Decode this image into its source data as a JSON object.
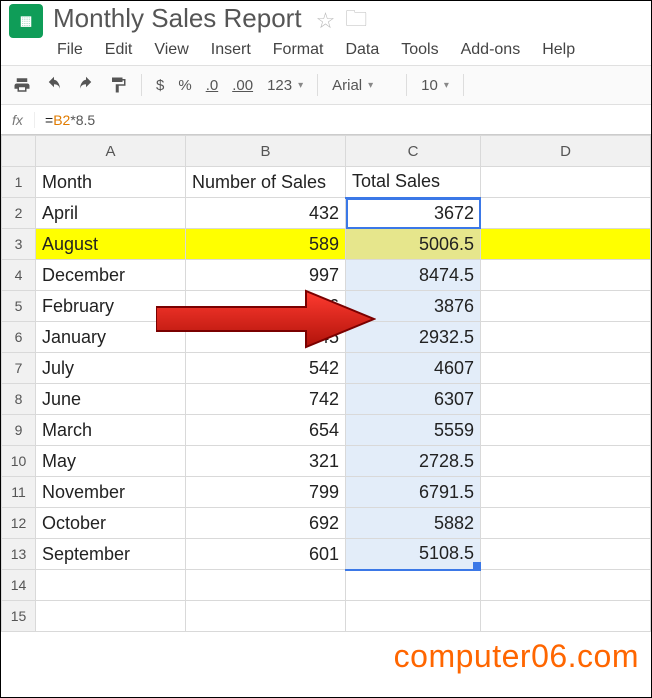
{
  "doc_title": "Monthly Sales Report",
  "menus": [
    "File",
    "Edit",
    "View",
    "Insert",
    "Format",
    "Data",
    "Tools",
    "Add-ons",
    "Help"
  ],
  "toolbar": {
    "currency": "$",
    "percent": "%",
    "dec_dec": ".0",
    "dec_inc": ".00",
    "numfmt": "123",
    "font": "Arial",
    "size": "10"
  },
  "formula_ref": "B2",
  "formula_rest": "*8.5",
  "columns": [
    "A",
    "B",
    "C",
    "D"
  ],
  "headers": {
    "a": "Month",
    "b": "Number of Sales",
    "c": "Total Sales"
  },
  "rows": [
    {
      "n": 1,
      "a": "Month",
      "b": "Number of Sales",
      "c": "Total Sales",
      "hdr": true
    },
    {
      "n": 2,
      "a": "April",
      "b": "432",
      "c": "3672"
    },
    {
      "n": 3,
      "a": "August",
      "b": "589",
      "c": "5006.5",
      "hl": true
    },
    {
      "n": 4,
      "a": "December",
      "b": "997",
      "c": "8474.5"
    },
    {
      "n": 5,
      "a": "February",
      "b": "456",
      "c": "3876"
    },
    {
      "n": 6,
      "a": "January",
      "b": "345",
      "c": "2932.5"
    },
    {
      "n": 7,
      "a": "July",
      "b": "542",
      "c": "4607"
    },
    {
      "n": 8,
      "a": "June",
      "b": "742",
      "c": "6307"
    },
    {
      "n": 9,
      "a": "March",
      "b": "654",
      "c": "5559"
    },
    {
      "n": 10,
      "a": "May",
      "b": "321",
      "c": "2728.5"
    },
    {
      "n": 11,
      "a": "November",
      "b": "799",
      "c": "6791.5"
    },
    {
      "n": 12,
      "a": "October",
      "b": "692",
      "c": "5882"
    },
    {
      "n": 13,
      "a": "September",
      "b": "601",
      "c": "5108.5"
    },
    {
      "n": 14,
      "a": "",
      "b": "",
      "c": ""
    },
    {
      "n": 15,
      "a": "",
      "b": "",
      "c": ""
    }
  ],
  "watermark": "computer06.com"
}
